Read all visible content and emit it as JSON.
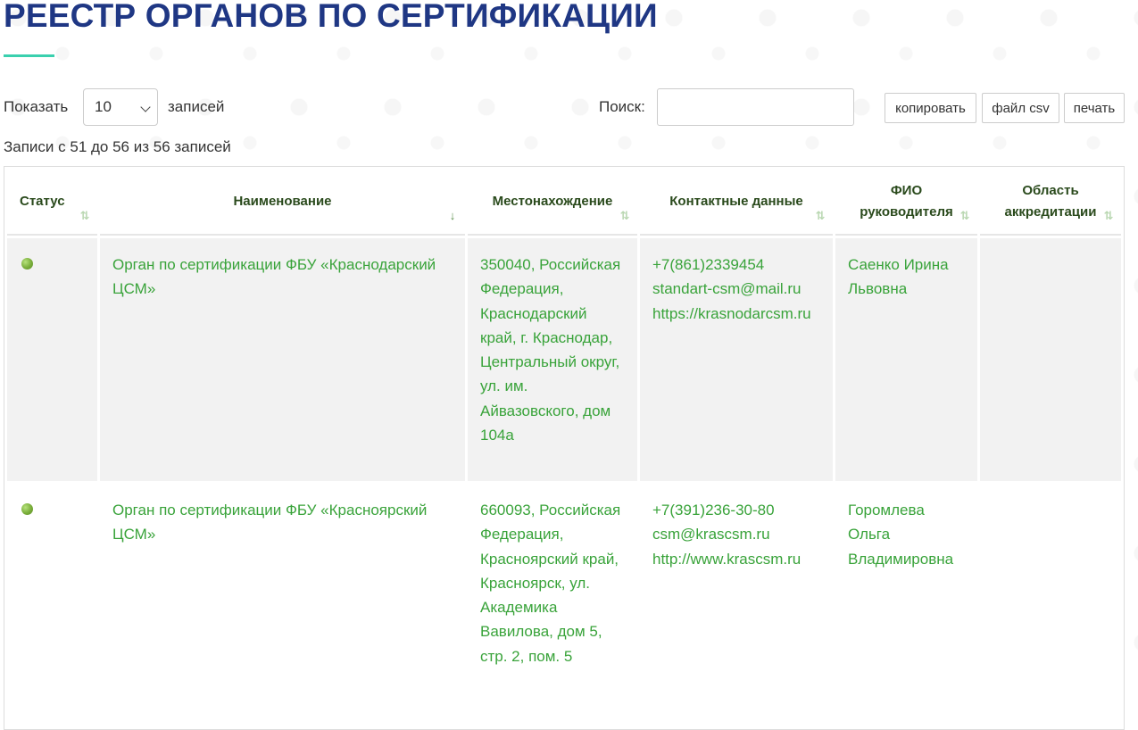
{
  "page": {
    "title": "РЕЕСТР ОРГАНОВ ПО СЕРТИФИКАЦИИ"
  },
  "controls": {
    "show_label": "Показать",
    "length_value": "10",
    "records_label": "записей",
    "search_label": "Поиск:",
    "search_value": "",
    "buttons": {
      "copy": "копировать",
      "csv": "файл csv",
      "print": "печать"
    }
  },
  "info": "Записи с 51 до 56 из 56 записей",
  "colors": {
    "title": "#1f3784",
    "accent_underline": "#3ad0ae",
    "link_green": "#39a33a",
    "header_text": "#2a4a1c",
    "status_active": "#79ad3a"
  },
  "table": {
    "columns": [
      {
        "label": "Статус",
        "sort": "sort-both-icon"
      },
      {
        "label": "Наименование",
        "sort": "sort-asc-icon"
      },
      {
        "label": "Местонахождение",
        "sort": "sort-both-icon"
      },
      {
        "label": "Контактные данные",
        "sort": "sort-both-icon"
      },
      {
        "label": "ФИО руководителя",
        "sort": "sort-both-icon"
      },
      {
        "label": "Область аккредитации",
        "sort": "sort-both-icon"
      }
    ],
    "rows": [
      {
        "status": "active",
        "name": "Орган по сертификации ФБУ «Краснодарский ЦСМ»",
        "location": "350040, Российская Федерация, Краснодарский край, г. Краснодар, Центральный округ, ул. им. Айвазовского, дом 104а",
        "phone": "+7(861)2339454",
        "email": "standart-csm@mail.ru",
        "website": "https://krasnodarcsm.ru",
        "head": "Саенко Ирина Львовна",
        "scope": ""
      },
      {
        "status": "active",
        "name": "Орган по сертификации ФБУ «Красноярский ЦСМ»",
        "location": "660093, Российская Федерация, Красноярский край, Красноярск, ул. Академика Вавилова, дом 5, стр. 2, пом. 5",
        "phone": "+7(391)236-30-80",
        "email": "csm@krascsm.ru",
        "website": "http://www.krascsm.ru",
        "head": "Горомлева Ольга Владимировна",
        "scope": ""
      }
    ]
  }
}
